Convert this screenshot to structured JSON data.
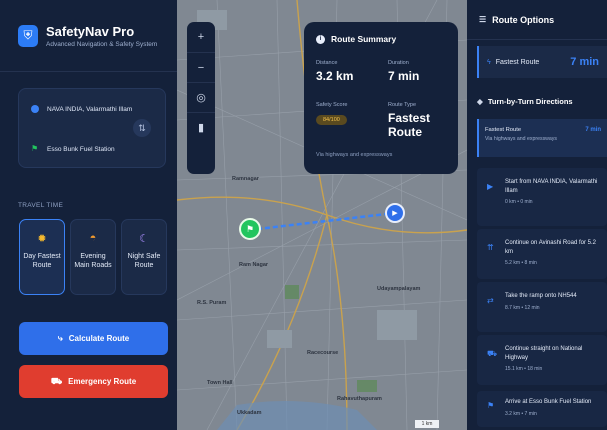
{
  "brand": {
    "title": "SafetyNav Pro",
    "subtitle": "Advanced Navigation & Safety System"
  },
  "route_inputs": {
    "origin": "NAVA INDIA, Valarmathi Illam",
    "destination": "Esso Bunk Fuel Station"
  },
  "travel_time": {
    "label": "TRAVEL TIME",
    "options": [
      {
        "label": "Day Fastest Route",
        "active": true
      },
      {
        "label": "Evening Main Roads",
        "active": false
      },
      {
        "label": "Night Safe Route",
        "active": false
      }
    ]
  },
  "buttons": {
    "calculate": "Calculate Route",
    "emergency": "Emergency Route"
  },
  "map": {
    "zoom_in": "+",
    "zoom_out": "−",
    "labels": {
      "ramnagar": "Ramnagar",
      "rs_puram": "R.S. Puram",
      "racecourse": "Racecourse",
      "town_hall": "Town Hall",
      "ram_nagar": "Ram Nagar",
      "rahavuthapuram": "Rahavuthapuram",
      "ukkadam": "Ukkadam",
      "udayampalayam": "Udayampalayam"
    },
    "scale": "1 km"
  },
  "summary": {
    "title": "Route Summary",
    "distance_label": "Distance",
    "distance": "3.2 km",
    "duration_label": "Duration",
    "duration": "7 min",
    "safety_label": "Safety Score",
    "safety": "84/100",
    "type_label": "Route Type",
    "type": "Fastest Route",
    "note": "Via highways and expressways"
  },
  "right": {
    "title": "Route Options",
    "fastest_label": "Fastest Route",
    "fastest_value": "7 min",
    "directions_title": "Turn-by-Turn Directions",
    "summary_row": {
      "title": "Fastest Route",
      "sub": "Via highways and expressways",
      "value": "7 min"
    },
    "steps": [
      {
        "text": "Start from NAVA INDIA, Valarmathi Illam",
        "sub": "0 km • 0 min"
      },
      {
        "text": "Continue on Avinashi Road for 5.2 km",
        "sub": "5.2 km • 8 min"
      },
      {
        "text": "Take the ramp onto NH544",
        "sub": "8.7 km • 12 min"
      },
      {
        "text": "Continue straight on National Highway",
        "sub": "15.1 km • 18 min"
      },
      {
        "text": "Arrive at Esso Bunk Fuel Station",
        "sub": "3.2 km • 7 min"
      }
    ]
  },
  "colors": {
    "accent": "#3b82f6",
    "danger": "#e03d2f",
    "panel": "#14213a"
  }
}
